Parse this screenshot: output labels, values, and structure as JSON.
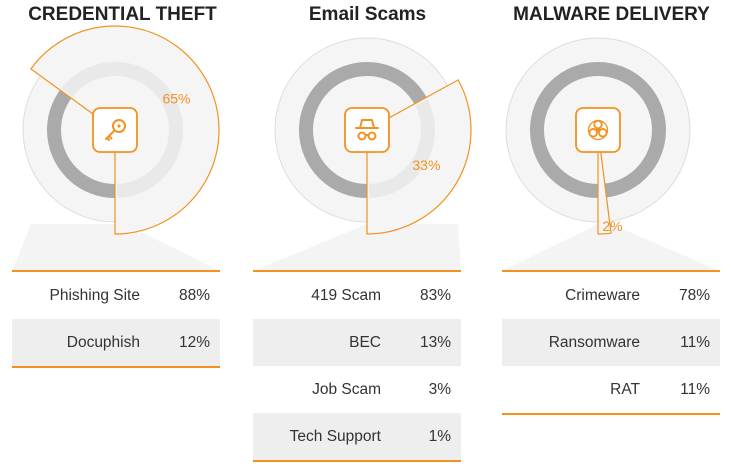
{
  "accent": "#f29220",
  "chart_data": [
    {
      "type": "pie",
      "title": "CREDENTIAL THEFT",
      "highlight": {
        "label": "65%",
        "value": 65
      },
      "icon": "key-icon",
      "breakdown": [
        {
          "label": "Phishing Site",
          "value": "88%"
        },
        {
          "label": "Docuphish",
          "value": "12%"
        }
      ]
    },
    {
      "type": "pie",
      "title": "Email Scams",
      "highlight": {
        "label": "33%",
        "value": 33
      },
      "icon": "spy-icon",
      "breakdown": [
        {
          "label": "419 Scam",
          "value": "83%"
        },
        {
          "label": "BEC",
          "value": "13%"
        },
        {
          "label": "Job Scam",
          "value": "3%"
        },
        {
          "label": "Tech Support",
          "value": "1%"
        }
      ]
    },
    {
      "type": "pie",
      "title": "MALWARE DELIVERY",
      "highlight": {
        "label": "2%",
        "value": 2
      },
      "icon": "biohazard-icon",
      "breakdown": [
        {
          "label": "Crimeware",
          "value": "78%"
        },
        {
          "label": "Ransomware",
          "value": "11%"
        },
        {
          "label": "RAT",
          "value": "11%"
        }
      ]
    }
  ]
}
